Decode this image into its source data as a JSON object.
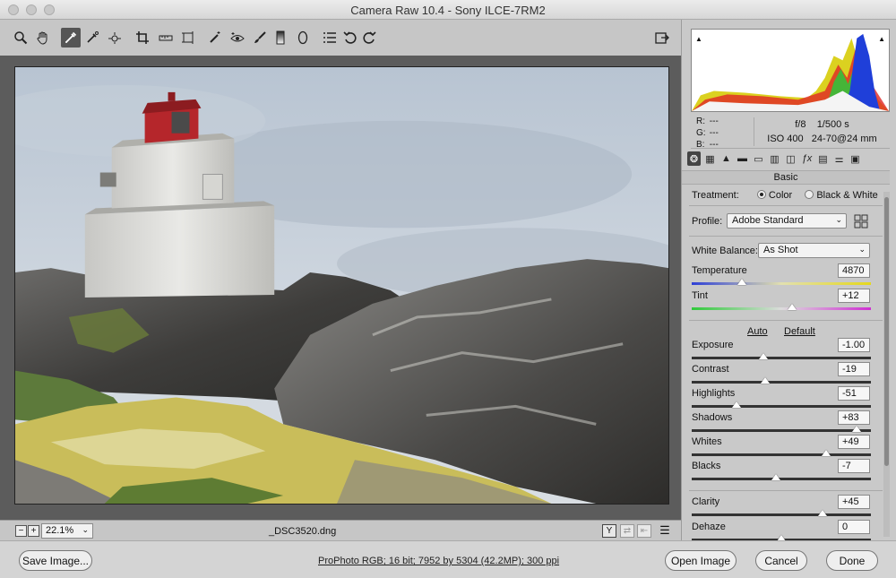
{
  "window": {
    "title": "Camera Raw 10.4  -  Sony ILCE-7RM2"
  },
  "toolbar": {
    "tools": [
      {
        "name": "zoom-tool",
        "icon": "magnifier-icon",
        "glyph": "⌕"
      },
      {
        "name": "hand-tool",
        "icon": "hand-icon",
        "glyph": "✋"
      },
      {
        "name": "white-balance-tool",
        "icon": "eyedropper-icon",
        "glyph": "⟋",
        "active": true
      },
      {
        "name": "color-sampler-tool",
        "icon": "color-sampler-icon",
        "glyph": "⟋"
      },
      {
        "name": "targeted-adjustment-tool",
        "icon": "target-icon",
        "glyph": "⊹"
      },
      {
        "name": "crop-tool",
        "icon": "crop-icon",
        "glyph": "⌗"
      },
      {
        "name": "straighten-tool",
        "icon": "level-icon",
        "glyph": "⊟"
      },
      {
        "name": "transform-tool",
        "icon": "transform-icon",
        "glyph": "⊡"
      },
      {
        "name": "spot-removal-tool",
        "icon": "brush-spot-icon",
        "glyph": "⟋"
      },
      {
        "name": "red-eye-tool",
        "icon": "eye-icon",
        "glyph": "⊕"
      },
      {
        "name": "adjustment-brush-tool",
        "icon": "brush-icon",
        "glyph": "⟋"
      },
      {
        "name": "graduated-filter-tool",
        "icon": "gradient-icon",
        "glyph": "▮"
      },
      {
        "name": "radial-filter-tool",
        "icon": "ellipse-icon",
        "glyph": "◯"
      },
      {
        "name": "preferences-tool",
        "icon": "list-icon",
        "glyph": "☰"
      },
      {
        "name": "rotate-left-tool",
        "icon": "rotate-ccw-icon",
        "glyph": "↺"
      },
      {
        "name": "rotate-right-tool",
        "icon": "rotate-cw-icon",
        "glyph": "↻"
      }
    ],
    "fullscreen_icon": "fullscreen-icon"
  },
  "preview_bar": {
    "zoom_minus": "−",
    "zoom_plus": "+",
    "zoom_level": "22.1%",
    "filename": "_DSC3520.dng",
    "before_after_label": "Y"
  },
  "info": {
    "r_label": "R:",
    "r_value": "---",
    "g_label": "G:",
    "g_value": "---",
    "b_label": "B:",
    "b_value": "---",
    "aperture": "f/8",
    "shutter": "1/500 s",
    "iso": "ISO 400",
    "lens": "24-70@24 mm"
  },
  "panel": {
    "section_title": "Basic",
    "treatment_label": "Treatment:",
    "treatment_color": "Color",
    "treatment_bw": "Black & White",
    "profile_label": "Profile:",
    "profile_value": "Adobe Standard",
    "wb_label": "White Balance:",
    "wb_value": "As Shot",
    "auto_label": "Auto",
    "default_label": "Default",
    "sliders": [
      {
        "key": "temperature",
        "label": "Temperature",
        "value": "4870",
        "position": 0.28,
        "track": "temperature"
      },
      {
        "key": "tint",
        "label": "Tint",
        "value": "+12",
        "position": 0.56,
        "track": "tint"
      },
      {
        "key": "exposure",
        "label": "Exposure",
        "value": "-1.00",
        "position": 0.4,
        "track": "plain"
      },
      {
        "key": "contrast",
        "label": "Contrast",
        "value": "-19",
        "position": 0.41,
        "track": "plain"
      },
      {
        "key": "highlights",
        "label": "Highlights",
        "value": "-51",
        "position": 0.25,
        "track": "plain"
      },
      {
        "key": "shadows",
        "label": "Shadows",
        "value": "+83",
        "position": 0.92,
        "track": "plain"
      },
      {
        "key": "whites",
        "label": "Whites",
        "value": "+49",
        "position": 0.75,
        "track": "plain"
      },
      {
        "key": "blacks",
        "label": "Blacks",
        "value": "-7",
        "position": 0.47,
        "track": "plain"
      },
      {
        "key": "clarity",
        "label": "Clarity",
        "value": "+45",
        "position": 0.73,
        "track": "plain"
      },
      {
        "key": "dehaze",
        "label": "Dehaze",
        "value": "0",
        "position": 0.5,
        "track": "plain"
      }
    ]
  },
  "bottom": {
    "save_label": "Save Image...",
    "workflow_text": "ProPhoto RGB; 16 bit; 7952 by 5304 (42.2MP); 300 ppi",
    "open_label": "Open Image",
    "cancel_label": "Cancel",
    "done_label": "Done"
  },
  "colors": {
    "accent": "#2f6fd6",
    "toolbar_bg": "#c6c6c6",
    "preview_bg": "#5c5c5c"
  }
}
